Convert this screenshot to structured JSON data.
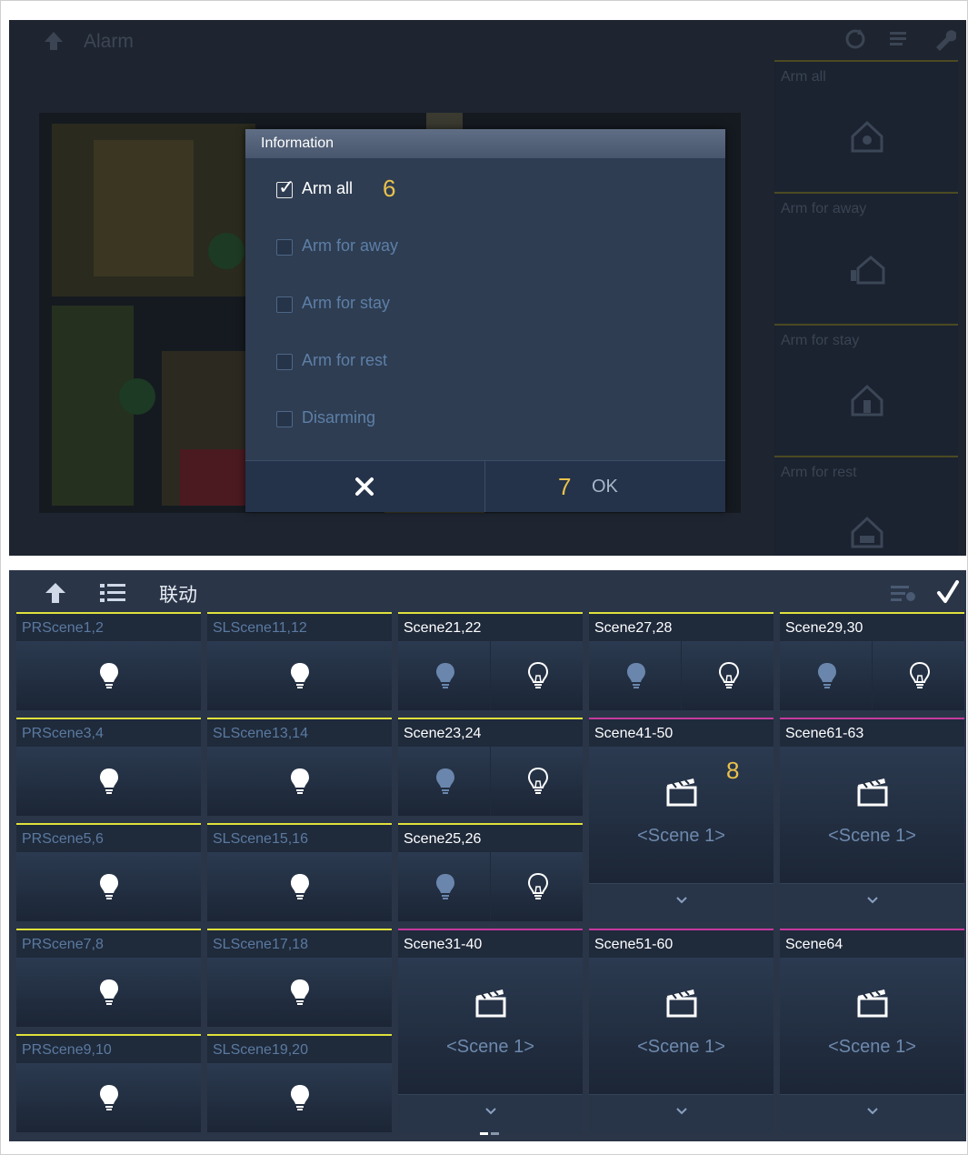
{
  "colors": {
    "yellow_line": "#dfe13a",
    "magenta_line": "#c63a9e",
    "annotation": "#e9c14c"
  },
  "top": {
    "header": {
      "back_icon": "back-arrow-icon",
      "title": "Alarm",
      "icons": [
        "refresh-icon",
        "list-icon",
        "wrench-icon"
      ]
    },
    "side_items": [
      {
        "label": "Arm all",
        "icon": "house-share-icon"
      },
      {
        "label": "Arm for away",
        "icon": "house-person-icon"
      },
      {
        "label": "Arm for stay",
        "icon": "house-stay-icon"
      },
      {
        "label": "Arm for rest",
        "icon": "house-bed-icon"
      }
    ],
    "dialog": {
      "title": "Information",
      "options": [
        {
          "label": "Arm all",
          "checked": true
        },
        {
          "label": "Arm for away",
          "checked": false
        },
        {
          "label": "Arm for stay",
          "checked": false
        },
        {
          "label": "Arm for rest",
          "checked": false
        },
        {
          "label": "Disarming",
          "checked": false
        }
      ],
      "cancel_icon": "close-x-icon",
      "ok_label": "OK",
      "annotation_6": "6",
      "annotation_7": "7"
    }
  },
  "bottom": {
    "header": {
      "back_icon": "back-arrow-icon",
      "list_icon": "list-icon",
      "title": "联动",
      "edit_icon": "edit-list-icon",
      "confirm_icon": "checkmark-icon"
    },
    "annotation_8": "8",
    "tiles": [
      {
        "name": "PRScene1,2",
        "kind": "single"
      },
      {
        "name": "SLScene11,12",
        "kind": "single"
      },
      {
        "name": "Scene21,22",
        "kind": "pair"
      },
      {
        "name": "Scene27,28",
        "kind": "pair"
      },
      {
        "name": "Scene29,30",
        "kind": "pair"
      },
      {
        "name": "PRScene3,4",
        "kind": "single"
      },
      {
        "name": "SLScene13,14",
        "kind": "single"
      },
      {
        "name": "Scene23,24",
        "kind": "pair"
      },
      {
        "name": "Scene41-50",
        "kind": "scene",
        "caption": "<Scene 1>"
      },
      {
        "name": "Scene61-63",
        "kind": "scene",
        "caption": "<Scene 1>"
      },
      {
        "name": "PRScene5,6",
        "kind": "single"
      },
      {
        "name": "SLScene15,16",
        "kind": "single"
      },
      {
        "name": "Scene25,26",
        "kind": "pair"
      },
      {
        "name": "PRScene7,8",
        "kind": "single"
      },
      {
        "name": "SLScene17,18",
        "kind": "single"
      },
      {
        "name": "Scene31-40",
        "kind": "scene",
        "caption": "<Scene 1>"
      },
      {
        "name": "Scene51-60",
        "kind": "scene",
        "caption": "<Scene 1>"
      },
      {
        "name": "Scene64",
        "kind": "scene",
        "caption": "<Scene 1>"
      },
      {
        "name": "PRScene9,10",
        "kind": "single"
      },
      {
        "name": "SLScene19,20",
        "kind": "single"
      }
    ],
    "dropdown_icon": "chevron-down-icon"
  }
}
